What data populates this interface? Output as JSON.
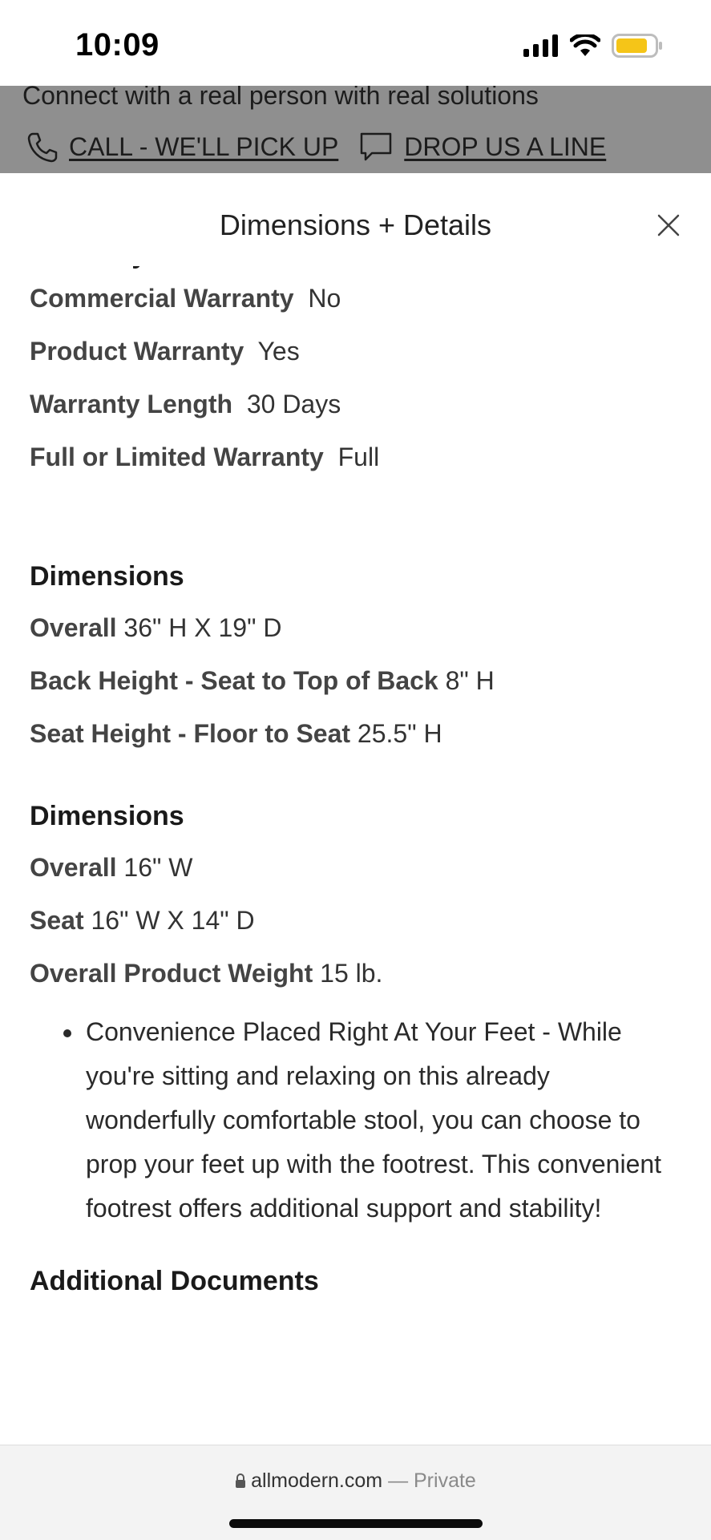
{
  "status": {
    "time": "10:09",
    "icons": [
      "signal-icon",
      "wifi-icon",
      "battery-icon"
    ],
    "battery_color": "#f5c518"
  },
  "banner": {
    "text": "Connect with a real person with real solutions",
    "call_label": "CALL - WE'LL PICK UP",
    "drop_label": "DROP US A LINE",
    "background": "#8f8f8f"
  },
  "sheet": {
    "title": "Dimensions + Details",
    "warranty_heading": "Warranty",
    "warranty": [
      {
        "label": "Commercial Warranty",
        "value": "No"
      },
      {
        "label": "Product Warranty",
        "value": "Yes"
      },
      {
        "label": "Warranty Length",
        "value": "30 Days"
      },
      {
        "label": "Full or Limited Warranty",
        "value": "Full"
      }
    ],
    "dimensions1_heading": "Dimensions",
    "dimensions1": [
      {
        "label": "Overall",
        "value": "36\" H X 19\" D"
      },
      {
        "label": "Back Height - Seat to Top of Back",
        "value": "8\" H"
      },
      {
        "label": "Seat Height - Floor to Seat",
        "value": "25.5\" H"
      }
    ],
    "dimensions2_heading": "Dimensions",
    "dimensions2": [
      {
        "label": "Overall",
        "value": "16\" W"
      },
      {
        "label": "Seat",
        "value": "16\" W X 14\" D"
      },
      {
        "label": "Overall Product Weight",
        "value": "15 lb."
      }
    ],
    "feature": "Convenience Placed Right At Your Feet - While you're sitting and relaxing on this already wonderfully comfortable stool, you can choose to prop your feet up with the footrest. This convenient footrest offers additional support and stability!",
    "docs_heading": "Additional Documents"
  },
  "browser": {
    "domain": "allmodern.com",
    "suffix": "— Private"
  }
}
